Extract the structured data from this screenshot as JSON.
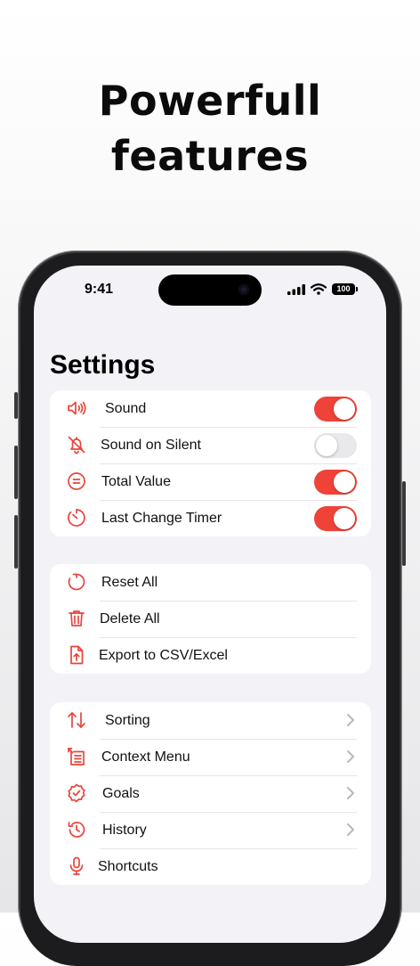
{
  "headline": {
    "line1": "Powerfull",
    "line2": "features"
  },
  "status_bar": {
    "time": "9:41",
    "battery": "100"
  },
  "settings": {
    "title": "Settings",
    "toggles": [
      {
        "label": "Sound",
        "icon": "speaker-icon",
        "on": true
      },
      {
        "label": "Sound on Silent",
        "icon": "bell-slash-icon",
        "on": false
      },
      {
        "label": "Total Value",
        "icon": "equal-circle-icon",
        "on": true
      },
      {
        "label": "Last Change Timer",
        "icon": "timer-icon",
        "on": true
      }
    ],
    "actions": [
      {
        "label": "Reset All",
        "icon": "reset-icon"
      },
      {
        "label": "Delete All",
        "icon": "trash-icon"
      },
      {
        "label": "Export to CSV/Excel",
        "icon": "export-document-icon"
      }
    ],
    "navigation": [
      {
        "label": "Sorting",
        "icon": "sort-arrows-icon"
      },
      {
        "label": "Context Menu",
        "icon": "context-menu-icon"
      },
      {
        "label": "Goals",
        "icon": "checkmark-seal-icon"
      },
      {
        "label": "History",
        "icon": "history-icon"
      },
      {
        "label": "Shortcuts",
        "icon": "microphone-icon"
      }
    ]
  },
  "colors": {
    "accent": "#ef4339",
    "toggle_off": "#e9e9eb",
    "background": "#f2f2f7"
  }
}
